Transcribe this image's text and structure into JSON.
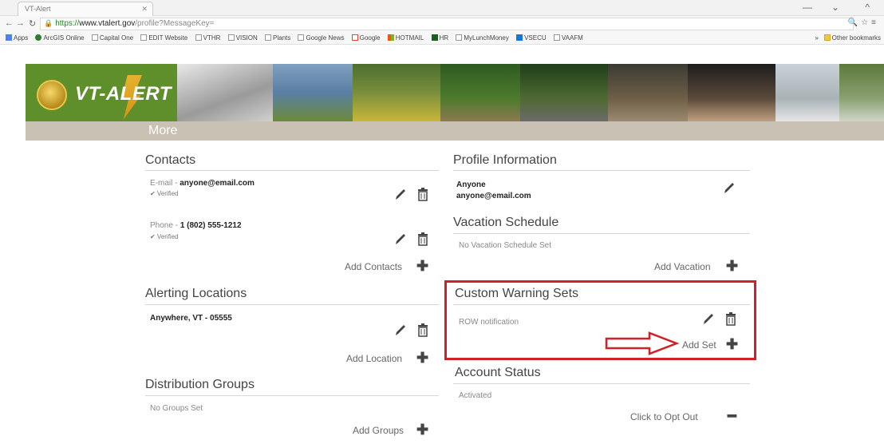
{
  "browser": {
    "tab_title": "VT-Alert",
    "url_scheme": "https://",
    "url_host": "www.vtalert.gov",
    "url_path": "/profile?MessageKey=",
    "bookmarks": [
      "Apps",
      "ArcGIS Online",
      "Capital One",
      "EDIT Website",
      "VTHR",
      "VISION",
      "Plants",
      "Google News",
      "Google",
      "HOTMAIL",
      "HR",
      "MyLunchMoney",
      "VSECU",
      "VAAFM"
    ],
    "other_bookmarks": "Other bookmarks",
    "overflow": "»"
  },
  "banner": {
    "logo_text": "VT-ALERT"
  },
  "more": {
    "label": "More"
  },
  "contacts": {
    "title": "Contacts",
    "email_label": "E-mail - ",
    "email_value": "anyone@email.com",
    "email_status": "✔ Verified",
    "phone_label": "Phone - ",
    "phone_value": "1 (802) 555-1212",
    "phone_status": "✔ Verified",
    "add_label": "Add Contacts"
  },
  "alerting_locations": {
    "title": "Alerting Locations",
    "location": "Anywhere, VT - 05555",
    "add_label": "Add Location"
  },
  "distribution_groups": {
    "title": "Distribution Groups",
    "empty": "No Groups Set",
    "add_label": "Add Groups"
  },
  "profile": {
    "title": "Profile Information",
    "name": "Anyone",
    "email": "anyone@email.com"
  },
  "vacation": {
    "title": "Vacation Schedule",
    "empty": "No Vacation Schedule Set",
    "add_label": "Add Vacation"
  },
  "custom_warning": {
    "title": "Custom Warning Sets",
    "item": "ROW notification",
    "add_label": "Add Set"
  },
  "account_status": {
    "title": "Account Status",
    "value": "Activated",
    "opt_out_label": "Click to Opt Out"
  },
  "colors": {
    "banner_green": "#5e8f2a",
    "more_bar": "#c9c1b3",
    "highlight_red": "#d12028"
  }
}
